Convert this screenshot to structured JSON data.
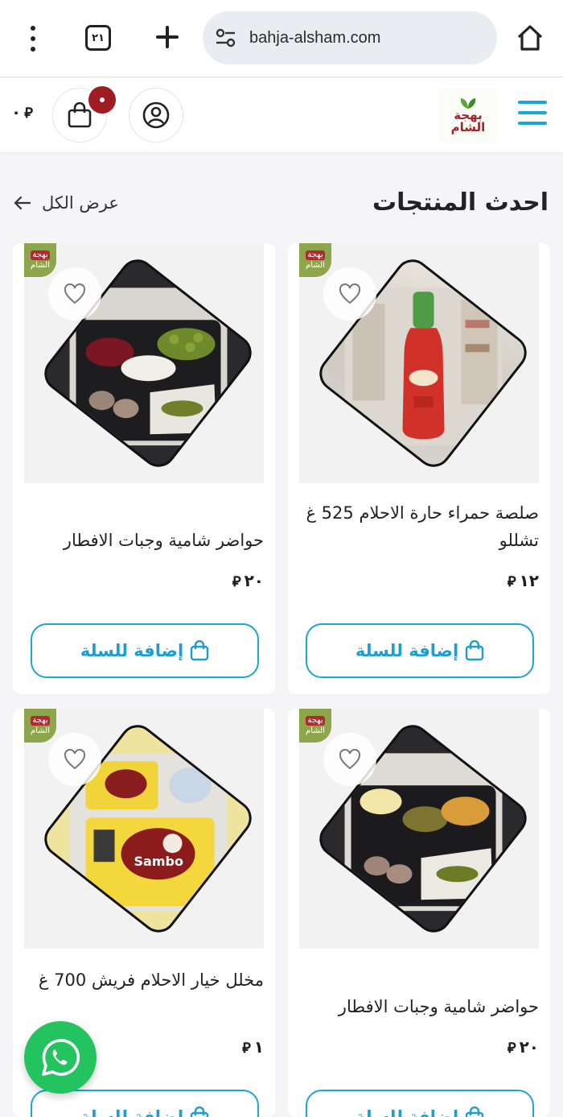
{
  "browser": {
    "tab_count": "٢١",
    "url": "bahja-alsham.com"
  },
  "header": {
    "cart_total": "٠",
    "currency_symbol": "⃁",
    "logo_text_line1": "بهجة",
    "logo_text_line2": "الشام",
    "accent_color": "#1aa7d8",
    "badge_color": "#9e1c22"
  },
  "section": {
    "title": "احدث المنتجات",
    "view_all": "عرض الكل"
  },
  "card_badge": {
    "line1": "بهجة",
    "line2": "الشام"
  },
  "products": [
    {
      "name": "صلصة حمراء حارة الاحلام 525 غ تشللو",
      "price": "١٢",
      "add_label": "إضافة للسلة",
      "image": "hot-sauce-bottle"
    },
    {
      "name": "حواضر شامية وجبات الافطار",
      "price": "٢٠",
      "add_label": "إضافة للسلة",
      "image": "breakfast-tray"
    },
    {
      "name": "حواضر شامية وجبات الافطار",
      "price": "٢٠",
      "add_label": "إضافة للسلة",
      "image": "breakfast-tray"
    },
    {
      "name": "مخلل خيار الاحلام فريش 700 غ",
      "price": "١",
      "add_label": "إضافة للسلة",
      "image": "sambo-halawa-cup"
    }
  ]
}
